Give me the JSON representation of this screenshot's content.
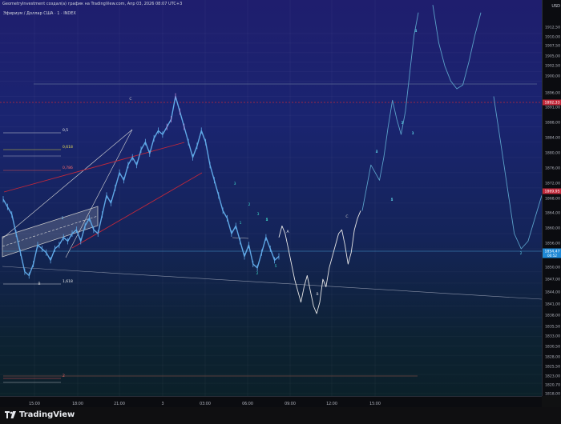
{
  "header": {
    "title": "GeometryInvestment создал(а) график на TradingView.com, Апр 03, 2026 08:07 UTC+3",
    "symbol": "Эфириум / Доллар США · 1 · INDEX"
  },
  "footer": {
    "brand": "TradingView",
    "logo_icon": "tradingview-logo-icon"
  },
  "colors": {
    "candle": "#5fa8e6",
    "candle_peak": "#b98ad4",
    "projection": "#5aa0c8",
    "bg_top": "#1f1e6e",
    "bg_bottom": "#0b2029",
    "red_line": "#c2283a",
    "last_price_bg": "#1e88d6",
    "red_label_bg": "#c2283a"
  },
  "chart_data": {
    "type": "line",
    "ylabel": "USD",
    "ylim": [
      1818.0,
      1915.0
    ],
    "y_ticks": [
      "1912,50",
      "1910,00",
      "1907,50",
      "1905,00",
      "1902,50",
      "1900,00",
      "1896,00",
      "1891,00",
      "1888,00",
      "1884,00",
      "1880,00",
      "1876,00",
      "1872,00",
      "1868,00",
      "1864,00",
      "1860,00",
      "1856,00",
      "1850,00",
      "1847,00",
      "1844,00",
      "1841,00",
      "1838,00",
      "1835,50",
      "1833,00",
      "1830,50",
      "1828,00",
      "1825,50",
      "1823,00",
      "1820,70",
      "1818,00"
    ],
    "x_ticks": [
      "15:00",
      "18:00",
      "21:00",
      "3",
      "03:00",
      "06:00",
      "09:00",
      "12:00",
      "15:00"
    ],
    "price_labels": [
      {
        "text": "1892,33",
        "kind": "red"
      },
      {
        "text": "1869,95",
        "kind": "red"
      },
      {
        "text": "1854,47",
        "sub": "00:52",
        "kind": "last"
      }
    ],
    "series": [
      {
        "values": [
          1869,
          1867,
          1865,
          1860,
          1855,
          1850,
          1849,
          1852,
          1857,
          1856,
          1855,
          1853,
          1856,
          1857,
          1859,
          1858,
          1860,
          1861,
          1858,
          1862,
          1864,
          1861,
          1860,
          1865,
          1870,
          1868,
          1872,
          1876,
          1874,
          1878,
          1880,
          1878,
          1882,
          1884,
          1881,
          1885,
          1887,
          1886,
          1888,
          1890,
          1896,
          1892,
          1888,
          1884,
          1880,
          1883,
          1887,
          1884,
          1878,
          1874,
          1870,
          1866,
          1864,
          1860,
          1862,
          1858,
          1854,
          1857,
          1852,
          1851,
          1855,
          1859,
          1856,
          1853,
          1854
        ]
      },
      {
        "values": [
          1859,
          1862,
          1860,
          1856,
          1852,
          1848,
          1845,
          1842,
          1846,
          1849,
          1845,
          1841,
          1839,
          1842,
          1848,
          1846,
          1851,
          1854,
          1857,
          1860,
          1861,
          1857,
          1852,
          1855,
          1861,
          1864,
          1866
        ]
      },
      {
        "values": [
          1866,
          1872,
          1878,
          1876,
          1874,
          1880,
          1888,
          1895,
          1890,
          1886,
          1892,
          1902,
          1912,
          1918
        ]
      },
      {
        "values": [
          1920,
          1910,
          1904,
          1900,
          1898,
          1899,
          1905,
          1912,
          1918
        ]
      },
      {
        "values": [
          1896,
          1884,
          1872,
          1860,
          1856,
          1858,
          1864,
          1870
        ]
      }
    ],
    "fib_levels": [
      {
        "label": "0,5"
      },
      {
        "label": "0,618"
      },
      {
        "label": "0,786"
      },
      {
        "label": "1,618"
      },
      {
        "label": "2"
      }
    ],
    "wave_labels": [
      "B",
      "C",
      "A",
      "B",
      "C",
      "1",
      "2",
      "3",
      "4",
      "5",
      "1",
      "2",
      "3",
      "4",
      "5",
      "1",
      "1",
      "2",
      "3",
      "4",
      "5",
      "2",
      "3",
      "4",
      "5"
    ]
  }
}
